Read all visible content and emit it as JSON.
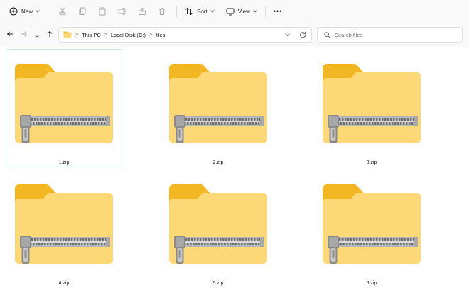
{
  "toolbar": {
    "new_label": "New",
    "sort_label": "Sort",
    "view_label": "View",
    "more_label": "•••",
    "icons": [
      "new-icon",
      "cut-icon",
      "copy-icon",
      "paste-icon",
      "rename-icon",
      "share-icon",
      "delete-icon",
      "sort-icon",
      "view-icon"
    ]
  },
  "navigation": {
    "breadcrumb": [
      "This PC",
      "Local Disk (C:)",
      "files"
    ],
    "separator": ">"
  },
  "search": {
    "placeholder": "Search files"
  },
  "files": [
    {
      "name": "1.zip",
      "selected": true
    },
    {
      "name": "2.zip",
      "selected": false
    },
    {
      "name": "3.zip",
      "selected": false
    },
    {
      "name": "4.zip",
      "selected": false
    },
    {
      "name": "5.zip",
      "selected": false
    },
    {
      "name": "6.zip",
      "selected": false
    }
  ],
  "colors": {
    "folder_back": "#f3b724",
    "folder_front": "#fcd877",
    "zipper": "#8a8a8a",
    "selection_border": "#cfe8f4",
    "accent": "#0067c0"
  }
}
